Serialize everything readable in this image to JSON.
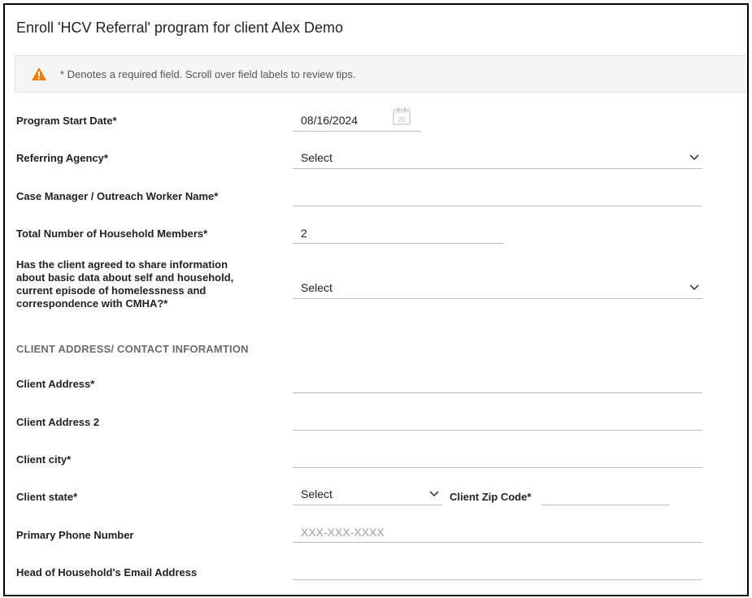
{
  "header": {
    "title": "Enroll 'HCV Referral' program for client Alex Demo"
  },
  "notice": {
    "text": "* Denotes a required field. Scroll over field labels to review tips.",
    "icon": "warning-icon",
    "icon_color": "#f57c00"
  },
  "fields": {
    "program_start_date": {
      "label": "Program Start Date*",
      "value": "08/16/2024",
      "calendar_day": "25"
    },
    "referring_agency": {
      "label": "Referring Agency*",
      "value": "Select"
    },
    "case_manager": {
      "label": "Case Manager / Outreach Worker Name*",
      "value": ""
    },
    "household_members": {
      "label": "Total Number of Household Members*",
      "value": "2"
    },
    "consent": {
      "label_lines": [
        "Has the client agreed to share information",
        "about basic data about self and household,",
        "current episode of homelessness and",
        "correspondence with CMHA?*"
      ],
      "value": "Select"
    },
    "address": {
      "label": "Client Address*",
      "value": ""
    },
    "address2": {
      "label": "Client Address 2",
      "value": ""
    },
    "city": {
      "label": "Client city*",
      "value": ""
    },
    "state": {
      "label": "Client state*",
      "value": "Select"
    },
    "zip": {
      "label": "Client Zip Code*",
      "value": ""
    },
    "phone": {
      "label": "Primary Phone Number",
      "value": "",
      "placeholder": "XXX-XXX-XXXX"
    },
    "email": {
      "label": "Head of Household's Email Address",
      "value": ""
    }
  },
  "section": {
    "contact_heading": "CLIENT ADDRESS/ CONTACT INFORAMTION"
  }
}
